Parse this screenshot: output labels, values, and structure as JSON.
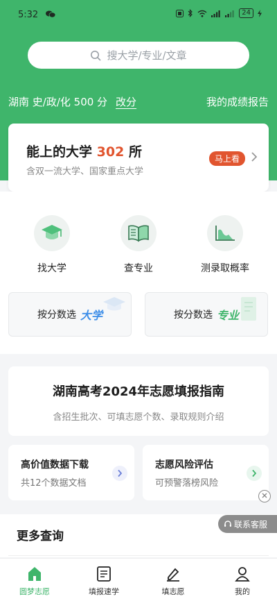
{
  "status_bar": {
    "time": "5:32",
    "battery": "24"
  },
  "search": {
    "placeholder": "搜大学/专业/文章"
  },
  "score": {
    "summary": "湖南 史/政/化 500 分",
    "edit_label": "改分",
    "report_label": "我的成绩报告"
  },
  "reachable": {
    "title_prefix": "能上的大学",
    "count": "302",
    "title_suffix": "所",
    "subtitle": "含双一流大学、国家重点大学",
    "button_label": "马上看"
  },
  "functions": [
    {
      "label": "找大学",
      "icon": "graduation-cap-icon"
    },
    {
      "label": "查专业",
      "icon": "book-icon"
    },
    {
      "label": "测录取概率",
      "icon": "chart-icon"
    }
  ],
  "pick_by_score": [
    {
      "label": "按分数选",
      "accent": "大学",
      "accent_color": "#3d8ee8"
    },
    {
      "label": "按分数选",
      "accent": "专业",
      "accent_color": "#3fb56b"
    }
  ],
  "guide": {
    "title": "湖南高考2024年志愿填报指南",
    "subtitle": "含招生批次、可填志愿个数、录取规则介绍"
  },
  "mini_cards": [
    {
      "title": "高价值数据下载",
      "subtitle": "共12个数据文档",
      "accent": "#6b7fd7",
      "bg": "#eef0fb"
    },
    {
      "title": "志愿风险评估",
      "subtitle": "可预警落榜风险",
      "accent": "#3fb56b",
      "bg": "#e8f6ee"
    }
  ],
  "service_label": "联系客服",
  "more_title": "更多查询",
  "tabs": [
    {
      "label": "圆梦志愿",
      "icon": "home-icon",
      "active": true
    },
    {
      "label": "填报速学",
      "icon": "document-icon",
      "active": false
    },
    {
      "label": "填志愿",
      "icon": "pen-icon",
      "active": false
    },
    {
      "label": "我的",
      "icon": "user-icon",
      "active": false
    }
  ],
  "colors": {
    "brand_green": "#3fb56b",
    "highlight_orange": "#e1552f"
  }
}
